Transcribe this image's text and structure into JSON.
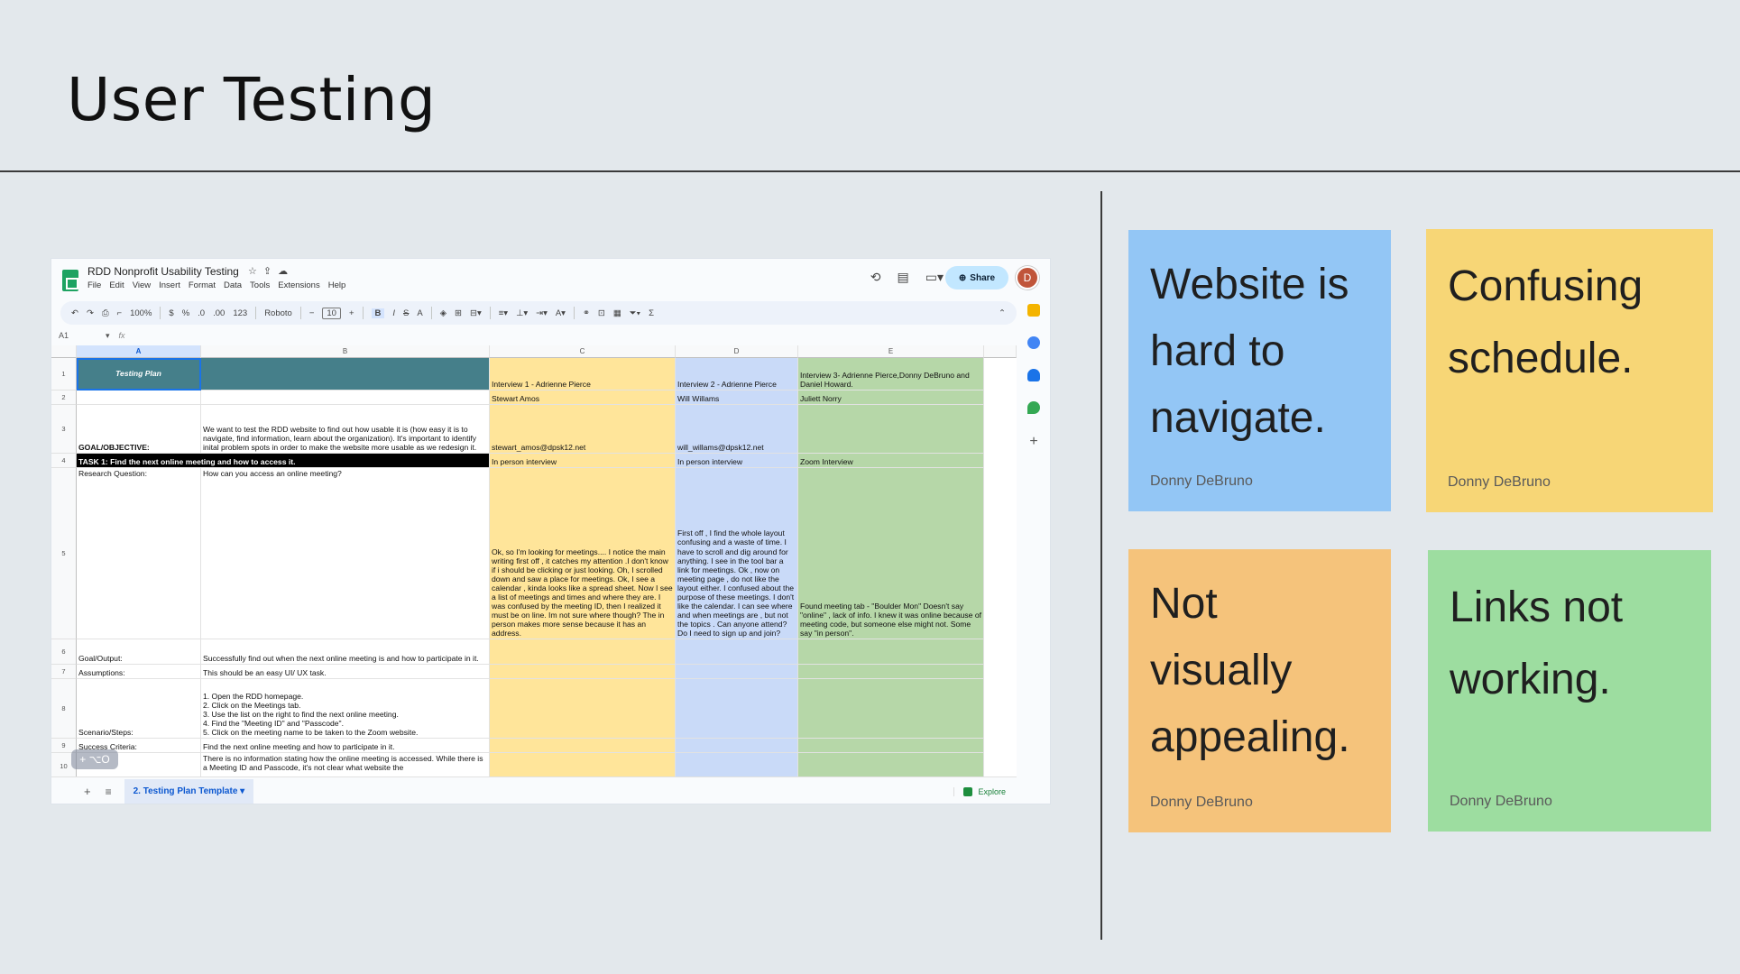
{
  "slide": {
    "title": "User Testing"
  },
  "sheet": {
    "doc_title": "RDD Nonprofit Usability Testing",
    "menu": [
      "File",
      "Edit",
      "View",
      "Insert",
      "Format",
      "Data",
      "Tools",
      "Extensions",
      "Help"
    ],
    "share_label": "Share",
    "avatar_initial": "D",
    "toolbar": {
      "zoom": "100%",
      "currency": "$",
      "percent": "%",
      "dec_decrease": ".0",
      "dec_increase": ".00",
      "format_123": "123",
      "font": "Roboto",
      "font_size": "10",
      "bold": "B",
      "italic": "I",
      "strike": "S",
      "text_color": "A",
      "minus": "−",
      "plus": "+",
      "sum": "Σ"
    },
    "name_box": "A1",
    "fx": "fx",
    "columns": [
      "A",
      "B",
      "C",
      "D",
      "E"
    ],
    "rows": [
      "1",
      "2",
      "3",
      "4",
      "5",
      "6",
      "7",
      "8",
      "9",
      "10"
    ],
    "cells": {
      "r1": {
        "a": "Testing Plan",
        "b": "",
        "c": "Interview 1 - Adrienne Pierce",
        "d": "Interview 2 - Adrienne Pierce",
        "e": "Interview 3- Adrienne Pierce,Donny DeBruno and Daniel Howard."
      },
      "r2": {
        "a": "",
        "b": "",
        "c": "Stewart Amos",
        "d": "Will Willams",
        "e": "Juliett  Norry"
      },
      "r3": {
        "a": "GOAL/OBJECTIVE:",
        "b": "We want to test the RDD website to find out how usable it is (how easy it is to navigate, find information, learn about the organization). It's important to identify inital problem spots in order to make the website more usable as we redesign it.",
        "c": "stewart_amos@dpsk12.net",
        "d": "will_willams@dpsk12.net",
        "e": ""
      },
      "r4": {
        "a": "TASK 1: Find the next online meeting and how to access it.",
        "c": "In person interview",
        "d": "In person interview",
        "e": "Zoom Interview"
      },
      "r5": {
        "a": "Research Question:",
        "b": "How can you access an online meeting?",
        "c": "Ok, so I'm looking for meetings.... I notice the main writing first off , it catches my attention .I don't know if i should be clicking or just looking. Oh, I scrolled down and saw a place for meetings. Ok, I see a calendar , kinda looks like a spread sheet. Now I see a list of meetings and times and where they are. I was confused by the meeting ID, then I realized it must be on line. Im not sure where though? The in person makes more sense because it has an address.",
        "d": "First off , I find the whole layout confusing and a waste of time. I have to scroll and dig around for anything. I see in the tool bar a link for meetings. Ok , now on meeting page , do not like the layout either. I confused about the purpose of these meetings. I don't like the calendar. I can see where and when meetings are , but not the topics . Can anyone attend? Do I need to sign up and join?",
        "e": "Found meeting tab - \"Boulder Mon\" Doesn't say \"online\" , lack of info. I knew it was online because of meeting code, but someone else might not. Some say \"in person\"."
      },
      "r6": {
        "a": "Goal/Output:",
        "b": "Successfully find out when the next online meeting is and how to participate in it."
      },
      "r7": {
        "a": "Assumptions:",
        "b": "This should be an easy UI/ UX task."
      },
      "r8": {
        "a": "Scenario/Steps:",
        "b": "1. Open the RDD homepage.\n2. Click on the Meetings tab.\n3. Use the list on the right to find the next online meeting.\n4. Find the \"Meeting ID\" and \"Passcode\".\n5. Click on the meeting name to be taken to the Zoom website."
      },
      "r9": {
        "a": "Success Criteria:",
        "b": "Find the next online meeting and how to participate in it."
      },
      "r10": {
        "a": "",
        "b": "There is no information stating how the online meeting is accessed. While there is a Meeting ID and Passcode, it's not clear what website the"
      }
    },
    "overlay_label": "+ ⌥O",
    "tab_label": "2. Testing Plan Template",
    "explore_label": "Explore"
  },
  "notes": [
    {
      "text": "Website is hard to navigate.",
      "author": "Donny DeBruno",
      "color": "#93c6f5"
    },
    {
      "text": "Confusing schedule.",
      "author": "Donny DeBruno",
      "color": "#f7d676"
    },
    {
      "text": "Not visually appealing.",
      "author": "Donny DeBruno",
      "color": "#f5c37b"
    },
    {
      "text": "Links not working.",
      "author": "Donny DeBruno",
      "color": "#9ddda0"
    }
  ]
}
